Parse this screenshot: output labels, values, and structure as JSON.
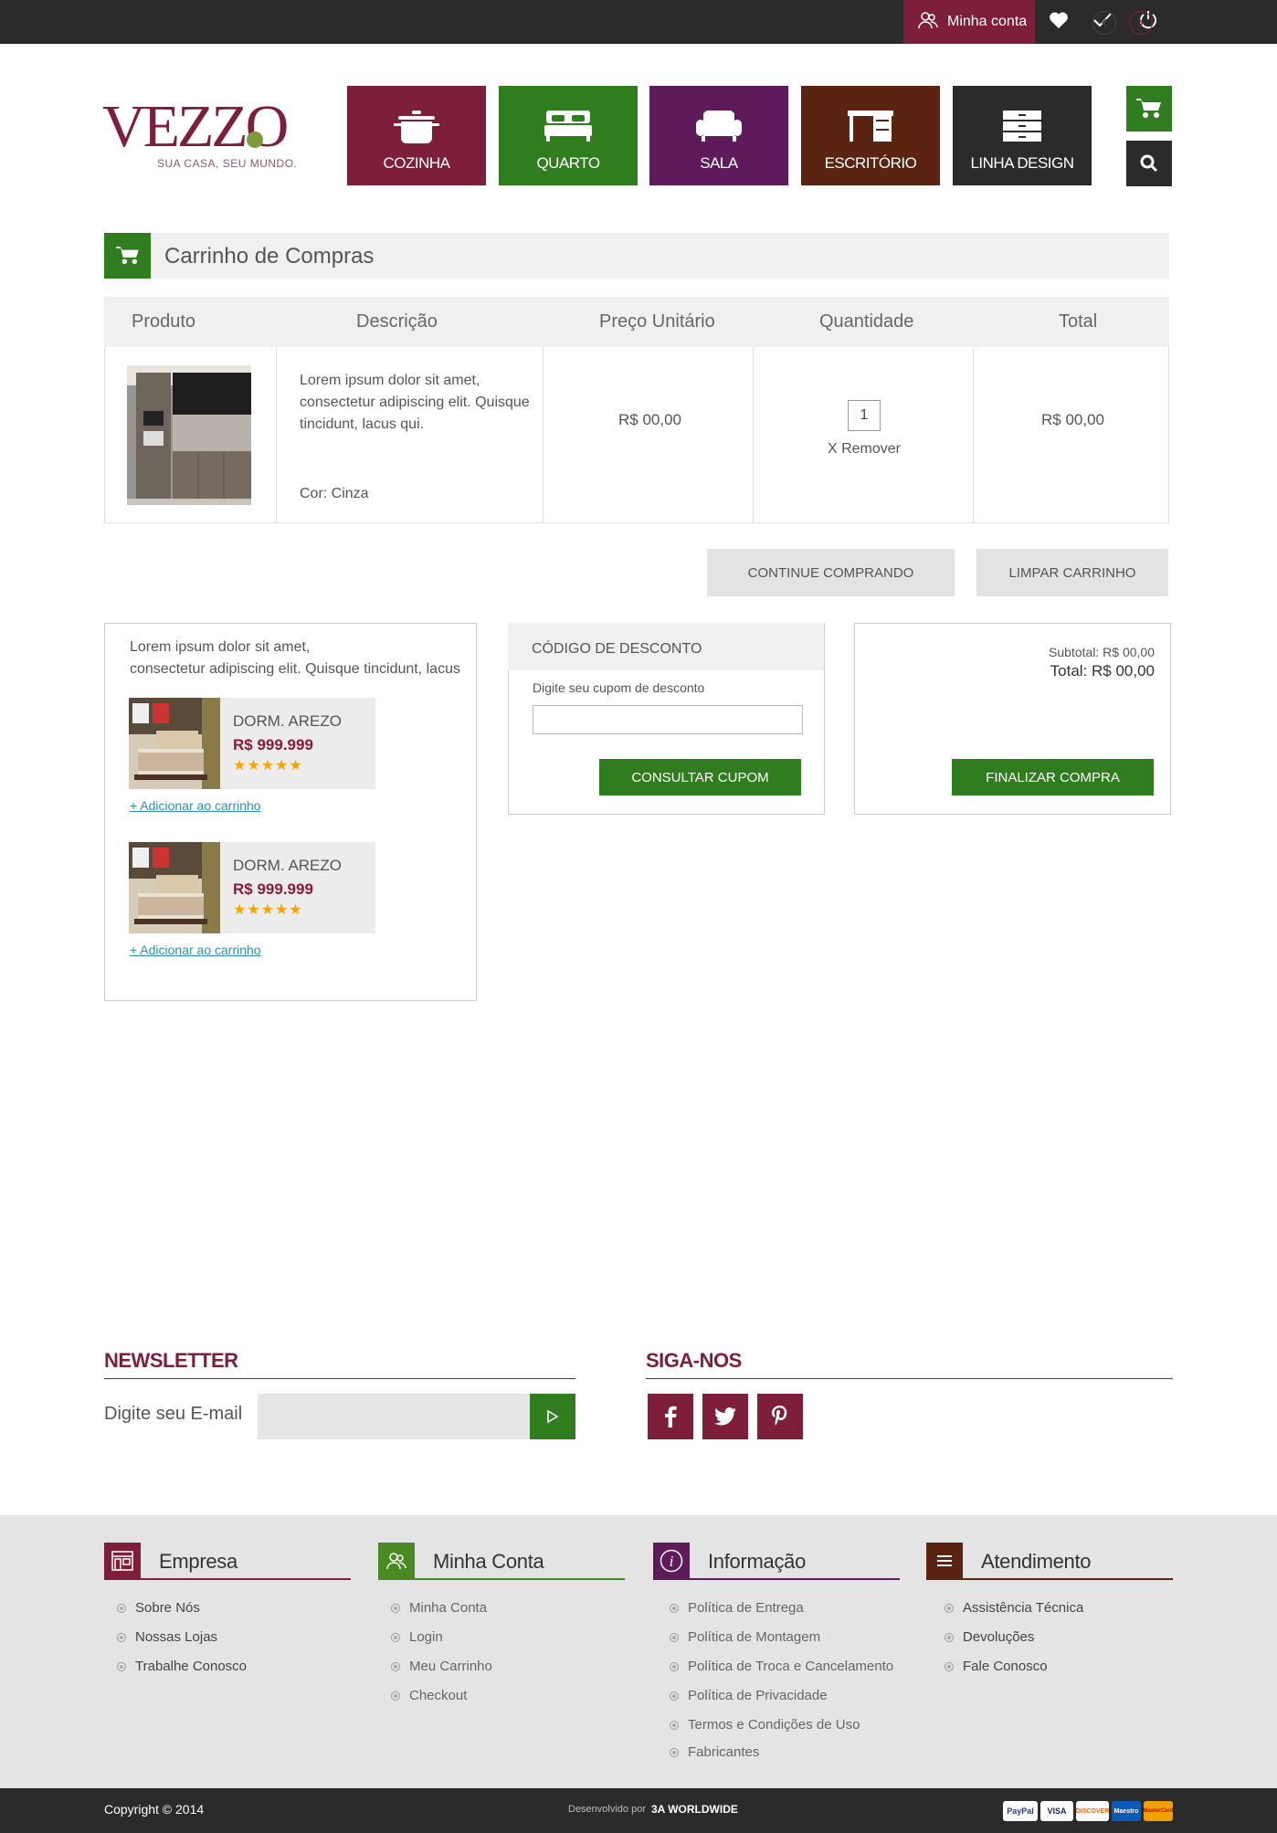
{
  "topbar": {
    "account_label": "Minha conta",
    "icons": [
      "heart-icon",
      "check-icon",
      "power-icon"
    ]
  },
  "logo": {
    "brand": "VEZZO",
    "tagline": "SUA CASA, SEU MUNDO."
  },
  "categories": [
    {
      "label": "COZINHA",
      "color": "#7d1f3b",
      "icon": "pot-icon"
    },
    {
      "label": "QUARTO",
      "color": "#2f7d1f",
      "icon": "bed-icon"
    },
    {
      "label": "SALA",
      "color": "#5e1a5b",
      "icon": "sofa-icon"
    },
    {
      "label": "ESCRITÓRIO",
      "color": "#5a2410",
      "icon": "desk-icon"
    },
    {
      "label": "LINHA DESIGN",
      "color": "#2b2b2b",
      "icon": "drawer-icon"
    }
  ],
  "cart": {
    "title": "Carrinho de Compras",
    "headers": [
      "Produto",
      "Descrição",
      "Preço Unitário",
      "Quantidade",
      "Total"
    ],
    "item": {
      "description": "Lorem ipsum dolor sit amet, consectetur adipiscing elit. Quisque tincidunt, lacus qui.",
      "color": "Cor: Cinza",
      "unit_price": "R$ 00,00",
      "quantity": "1",
      "remove": "X Remover",
      "total": "R$ 00,00"
    },
    "continue_label": "CONTINUE COMPRANDO",
    "clear_label": "LIMPAR CARRINHO"
  },
  "recommend": {
    "text_line1": "Lorem ipsum dolor sit amet,",
    "text_line2": "consectetur adipiscing elit. Quisque tincidunt, lacus",
    "products": [
      {
        "name": "DORM. AREZO",
        "price": "R$ 999.999",
        "stars": "★★★★★",
        "rating": 5,
        "add": "+ Adicionar ao carrinho"
      },
      {
        "name": "DORM. AREZO",
        "price": "R$ 999.999",
        "stars": "★★★★★",
        "rating": 5,
        "add": "+ Adicionar ao carrinho"
      }
    ]
  },
  "coupon": {
    "title": "CÓDIGO DE DESCONTO",
    "label": "Digite seu cupom de desconto",
    "button": "CONSULTAR CUPOM"
  },
  "summary": {
    "subtotal": "Subtotal: R$ 00,00",
    "total": "Total: R$ 00,00",
    "button": "FINALIZAR COMPRA"
  },
  "newsletter": {
    "title": "NEWSLETTER",
    "label": "Digite seu E-mail"
  },
  "social": {
    "title": "SIGA-NOS",
    "icons": [
      "facebook-icon",
      "twitter-icon",
      "pinterest-icon"
    ]
  },
  "footer": {
    "columns": [
      {
        "title": "Empresa",
        "color": "#7d1f3b",
        "links": [
          "Sobre Nós",
          "Nossas Lojas",
          "Trabalhe Conosco"
        ]
      },
      {
        "title": "Minha Conta",
        "color": "#4a8a22",
        "links": [
          "Minha Conta",
          "Login",
          "Meu Carrinho",
          "Checkout"
        ]
      },
      {
        "title": "Informação",
        "color": "#5e1a5b",
        "links": [
          "Política de Entrega",
          "Política de Montagem",
          "Política de Troca e Cancelamento",
          "Política de Privacidade",
          "Termos e Condições de Uso",
          "Fabricantes"
        ]
      },
      {
        "title": "Atendimento",
        "color": "#5a2410",
        "links": [
          "Assistência Técnica",
          "Devoluções",
          "Fale Conosco"
        ]
      }
    ],
    "copyright": "Copyright © 2014",
    "developed_by": "Desenvolvido por",
    "developer": "3A WORLDWIDE",
    "payments": [
      "PayPal",
      "VISA",
      "DISCOVER",
      "Maestro",
      "MasterCard"
    ]
  },
  "colors": {
    "wine": "#7d1f3b",
    "green": "#2f7d1f",
    "dark": "#2b2b2b"
  }
}
